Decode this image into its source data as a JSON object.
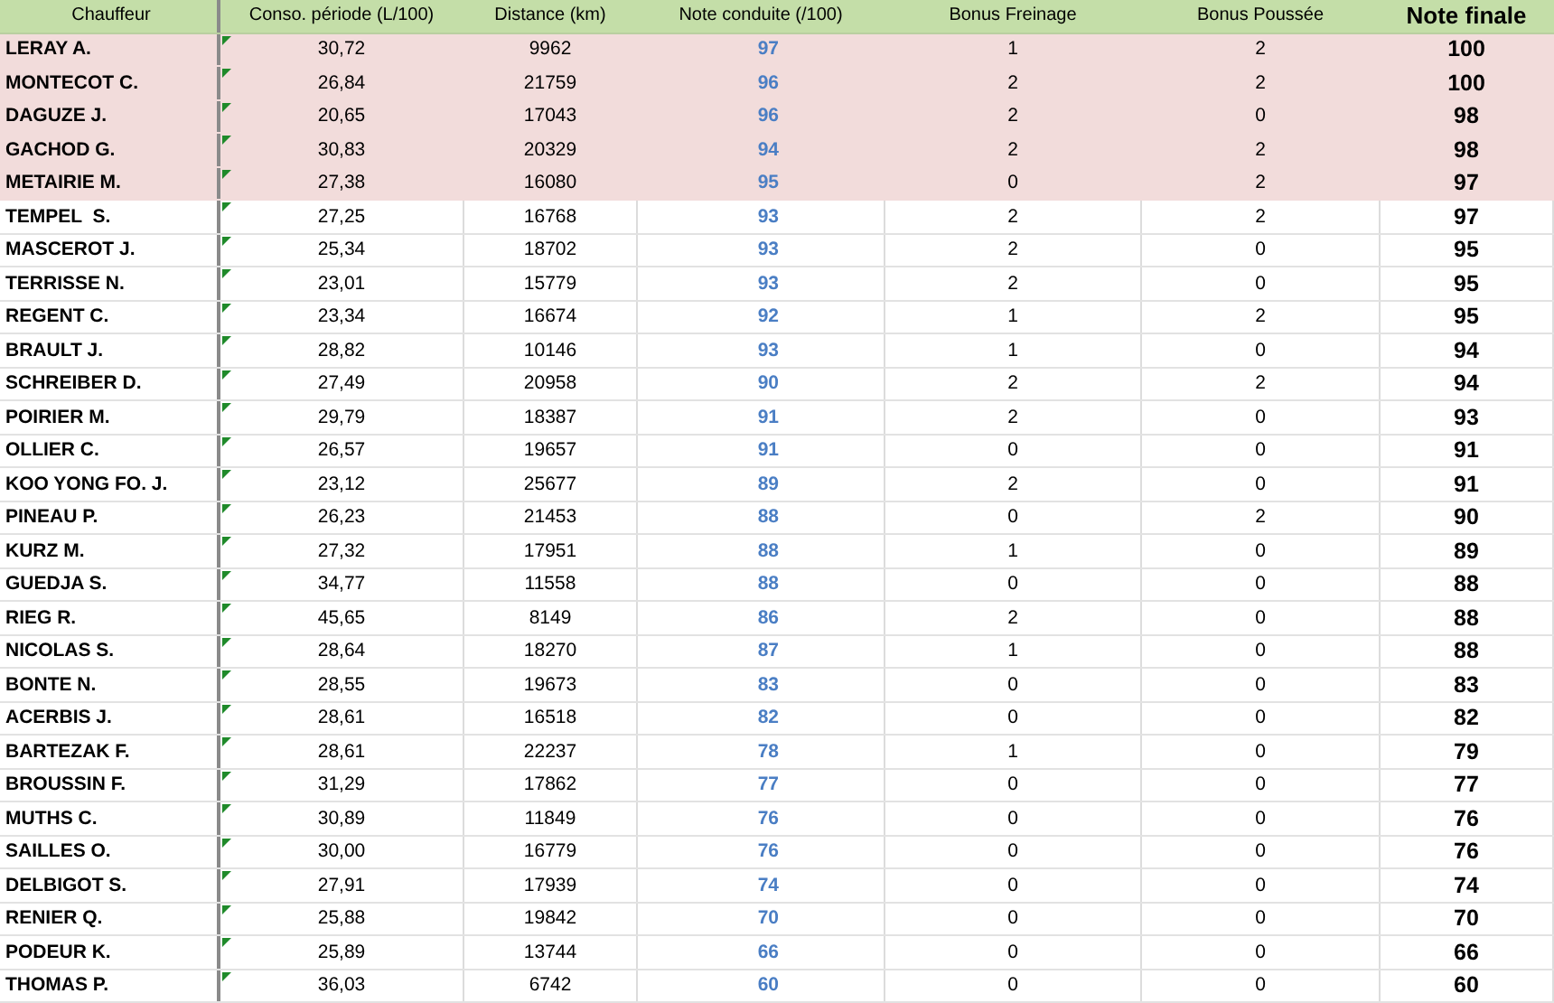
{
  "table": {
    "columns": [
      {
        "label": "Chauffeur",
        "kind": "name"
      },
      {
        "label": "Conso. période (L/100)",
        "kind": "plain"
      },
      {
        "label": "Distance (km)",
        "kind": "plain"
      },
      {
        "label": "Note conduite (/100)",
        "kind": "score"
      },
      {
        "label": "Bonus Freinage",
        "kind": "plain"
      },
      {
        "label": "Bonus Poussée",
        "kind": "plain"
      },
      {
        "label": "Note finale",
        "kind": "final"
      }
    ],
    "rows": [
      {
        "highlighted": true,
        "flagged": true,
        "cells": [
          "LERAY A.",
          "30,72",
          "9962",
          "97",
          "1",
          "2",
          "100"
        ]
      },
      {
        "highlighted": true,
        "flagged": true,
        "cells": [
          "MONTECOT C.",
          "26,84",
          "21759",
          "96",
          "2",
          "2",
          "100"
        ]
      },
      {
        "highlighted": true,
        "flagged": true,
        "cells": [
          "DAGUZE J.",
          "20,65",
          "17043",
          "96",
          "2",
          "0",
          "98"
        ]
      },
      {
        "highlighted": true,
        "flagged": true,
        "cells": [
          "GACHOD G.",
          "30,83",
          "20329",
          "94",
          "2",
          "2",
          "98"
        ]
      },
      {
        "highlighted": true,
        "flagged": true,
        "cells": [
          "METAIRIE M.",
          "27,38",
          "16080",
          "95",
          "0",
          "2",
          "97"
        ]
      },
      {
        "highlighted": false,
        "flagged": true,
        "cells": [
          "TEMPEL  S.",
          "27,25",
          "16768",
          "93",
          "2",
          "2",
          "97"
        ]
      },
      {
        "highlighted": false,
        "flagged": true,
        "cells": [
          "MASCEROT J.",
          "25,34",
          "18702",
          "93",
          "2",
          "0",
          "95"
        ]
      },
      {
        "highlighted": false,
        "flagged": true,
        "cells": [
          "TERRISSE N.",
          "23,01",
          "15779",
          "93",
          "2",
          "0",
          "95"
        ]
      },
      {
        "highlighted": false,
        "flagged": true,
        "cells": [
          "REGENT C.",
          "23,34",
          "16674",
          "92",
          "1",
          "2",
          "95"
        ]
      },
      {
        "highlighted": false,
        "flagged": true,
        "cells": [
          "BRAULT J.",
          "28,82",
          "10146",
          "93",
          "1",
          "0",
          "94"
        ]
      },
      {
        "highlighted": false,
        "flagged": true,
        "cells": [
          "SCHREIBER D.",
          "27,49",
          "20958",
          "90",
          "2",
          "2",
          "94"
        ]
      },
      {
        "highlighted": false,
        "flagged": true,
        "cells": [
          "POIRIER M.",
          "29,79",
          "18387",
          "91",
          "2",
          "0",
          "93"
        ]
      },
      {
        "highlighted": false,
        "flagged": true,
        "cells": [
          "OLLIER C.",
          "26,57",
          "19657",
          "91",
          "0",
          "0",
          "91"
        ]
      },
      {
        "highlighted": false,
        "flagged": true,
        "cells": [
          "KOO YONG FO. J.",
          "23,12",
          "25677",
          "89",
          "2",
          "0",
          "91"
        ]
      },
      {
        "highlighted": false,
        "flagged": true,
        "cells": [
          "PINEAU P.",
          "26,23",
          "21453",
          "88",
          "0",
          "2",
          "90"
        ]
      },
      {
        "highlighted": false,
        "flagged": true,
        "cells": [
          "KURZ M.",
          "27,32",
          "17951",
          "88",
          "1",
          "0",
          "89"
        ]
      },
      {
        "highlighted": false,
        "flagged": true,
        "cells": [
          "GUEDJA S.",
          "34,77",
          "11558",
          "88",
          "0",
          "0",
          "88"
        ]
      },
      {
        "highlighted": false,
        "flagged": true,
        "cells": [
          "RIEG R.",
          "45,65",
          "8149",
          "86",
          "2",
          "0",
          "88"
        ]
      },
      {
        "highlighted": false,
        "flagged": true,
        "cells": [
          "NICOLAS S.",
          "28,64",
          "18270",
          "87",
          "1",
          "0",
          "88"
        ]
      },
      {
        "highlighted": false,
        "flagged": true,
        "cells": [
          "BONTE N.",
          "28,55",
          "19673",
          "83",
          "0",
          "0",
          "83"
        ]
      },
      {
        "highlighted": false,
        "flagged": true,
        "cells": [
          "ACERBIS J.",
          "28,61",
          "16518",
          "82",
          "0",
          "0",
          "82"
        ]
      },
      {
        "highlighted": false,
        "flagged": true,
        "cells": [
          "BARTEZAK F.",
          "28,61",
          "22237",
          "78",
          "1",
          "0",
          "79"
        ]
      },
      {
        "highlighted": false,
        "flagged": true,
        "cells": [
          "BROUSSIN F.",
          "31,29",
          "17862",
          "77",
          "0",
          "0",
          "77"
        ]
      },
      {
        "highlighted": false,
        "flagged": true,
        "cells": [
          "MUTHS C.",
          "30,89",
          "11849",
          "76",
          "0",
          "0",
          "76"
        ]
      },
      {
        "highlighted": false,
        "flagged": true,
        "cells": [
          "SAILLES O.",
          "30,00",
          "16779",
          "76",
          "0",
          "0",
          "76"
        ]
      },
      {
        "highlighted": false,
        "flagged": true,
        "cells": [
          "DELBIGOT S.",
          "27,91",
          "17939",
          "74",
          "0",
          "0",
          "74"
        ]
      },
      {
        "highlighted": false,
        "flagged": true,
        "cells": [
          "RENIER Q.",
          "25,88",
          "19842",
          "70",
          "0",
          "0",
          "70"
        ]
      },
      {
        "highlighted": false,
        "flagged": true,
        "cells": [
          "PODEUR K.",
          "25,89",
          "13744",
          "66",
          "0",
          "0",
          "66"
        ]
      },
      {
        "highlighted": false,
        "flagged": true,
        "cells": [
          "THOMAS P.",
          "36,03",
          "6742",
          "60",
          "0",
          "0",
          "60"
        ]
      }
    ]
  }
}
